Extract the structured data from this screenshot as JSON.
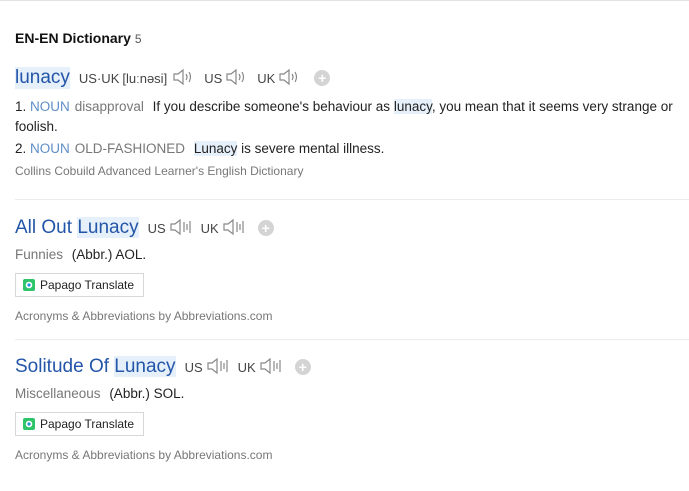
{
  "dictionary": {
    "title": "EN-EN Dictionary",
    "count": "5"
  },
  "entries": [
    {
      "word": "lunacy",
      "pron_label": "US·UK",
      "phonetic": "[luːnəsi]",
      "us_label": "US",
      "uk_label": "UK",
      "senses": [
        {
          "num": "1.",
          "pos": "NOUN",
          "gram": "disapproval",
          "text_before": "If you describe someone's behaviour as",
          "highlight": "lunacy",
          "text_after": ", you mean that it seems very strange or foolish."
        },
        {
          "num": "2.",
          "pos": "NOUN",
          "gram": "OLD-FASHIONED",
          "highlight": "Lunacy",
          "text_after": " is severe mental illness."
        }
      ],
      "source": "Collins Cobuild Advanced Learner's English Dictionary"
    },
    {
      "word_prefix": "All Out",
      "word_highlight": "Lunacy",
      "us_label": "US",
      "uk_label": "UK",
      "category": "Funnies",
      "abbr": "(Abbr.) AOL.",
      "papago": "Papago Translate",
      "source": "Acronyms & Abbreviations by Abbreviations.com"
    },
    {
      "word_prefix": "Solitude Of",
      "word_highlight": "Lunacy",
      "us_label": "US",
      "uk_label": "UK",
      "category": "Miscellaneous",
      "abbr": "(Abbr.) SOL.",
      "papago": "Papago Translate",
      "source": "Acronyms & Abbreviations by Abbreviations.com"
    }
  ],
  "icons": {
    "speaker": "speaker-icon",
    "add": "add-icon",
    "papago": "papago-icon"
  },
  "colors": {
    "word": "#2355a8",
    "pos": "#5e8ec7",
    "highlight": "#e6f0fa"
  }
}
